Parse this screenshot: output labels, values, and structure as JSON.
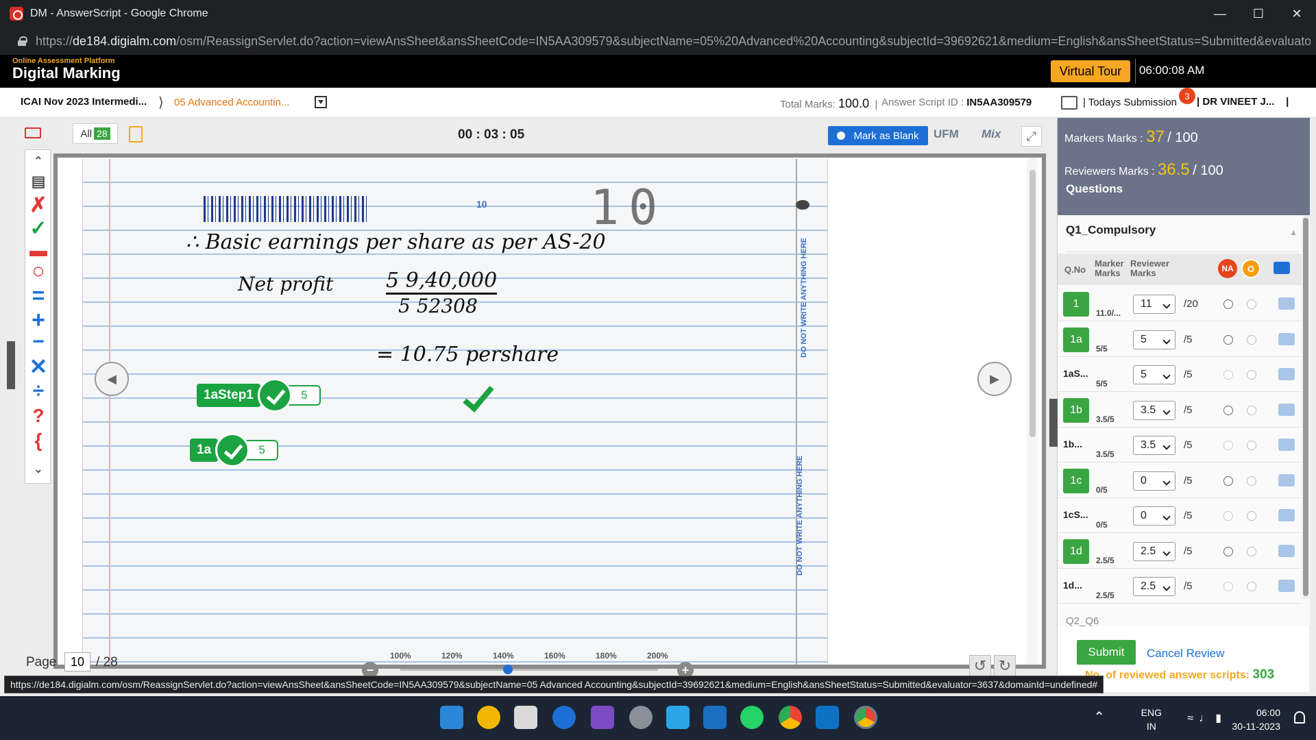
{
  "browser": {
    "title": "DM - AnswerScript - Google Chrome",
    "url_prefix": "https://",
    "url_host": "de184.digialm.com",
    "url_path": "/osm/ReassignServlet.do?action=viewAnsSheet&ansSheetCode=IN5AA309579&subjectName=05%20Advanced%20Accounting&subjectId=39692621&medium=English&ansSheetStatus=Submitted&evaluator=...",
    "status_url": "https://de184.digialm.com/osm/ReassignServlet.do?action=viewAnsSheet&ansSheetCode=IN5AA309579&subjectName=05 Advanced Accounting&subjectId=39692621&medium=English&ansSheetStatus=Submitted&evaluator=3637&domainId=undefined#"
  },
  "header": {
    "brand_sub": "Online Assessment Platform",
    "brand": "Digital Marking",
    "tour_label": "Virtual Tour",
    "clock": "06:00:08 AM"
  },
  "crumbs": {
    "exam": "ICAI Nov 2023 Intermedi...",
    "subject": "05 Advanced Accountin...",
    "total_marks_label": "Total Marks:",
    "total_marks": "100.0",
    "script_id_label": "Answer Script ID :",
    "script_id": "IN5AA309579",
    "todays_submission": "Todays Submission",
    "submission_badge": "3",
    "user": "DR VINEET J..."
  },
  "viewer": {
    "all_label": "All",
    "all_count": "28",
    "timer": "00 : 03 : 05",
    "mark_blank": "Mark as Blank",
    "ufm": "UFM",
    "mix": "Mix",
    "page_label": "Page",
    "page_value": "10",
    "page_total": "/ 28",
    "zoom_levels": [
      "100%",
      "120%",
      "140%",
      "160%",
      "180%",
      "200%"
    ]
  },
  "sheet": {
    "page_no": "10",
    "dots": "10",
    "line1": "∴  Basic  earnings  per share  as  per  AS-20",
    "line2": "Net profit",
    "numerator": "5 9,40,000",
    "denominator": "5 52308",
    "result": "=   10.75  pershare",
    "side_note": "DO NOT WRITE ANYTHING HERE",
    "annotations": [
      {
        "label": "1aStep1",
        "marks": "5"
      },
      {
        "label": "1a",
        "marks": "5"
      }
    ]
  },
  "panel": {
    "markers_label": "Markers Marks :",
    "markers_value": "37",
    "markers_total": "/ 100",
    "reviewers_label": "Reviewers Marks :",
    "reviewers_value": "36.5",
    "reviewers_total": "/ 100",
    "questions_label": "Questions",
    "section": "Q1_Compulsory",
    "col_qno": "Q.No",
    "col_marker": "Marker Marks",
    "col_reviewer": "Reviewer Marks",
    "na": "NA",
    "o": "O",
    "rows": [
      {
        "q": "1",
        "boxed": true,
        "marker": "11.0/...",
        "value": "11",
        "max": "/20"
      },
      {
        "q": "1a",
        "boxed": true,
        "marker": "5/5",
        "value": "5",
        "max": "/5"
      },
      {
        "q": "1aS...",
        "boxed": false,
        "marker": "5/5",
        "value": "5",
        "max": "/5"
      },
      {
        "q": "1b",
        "boxed": true,
        "marker": "3.5/5",
        "value": "3.5",
        "max": "/5"
      },
      {
        "q": "1b...",
        "boxed": false,
        "marker": "3.5/5",
        "value": "3.5",
        "max": "/5"
      },
      {
        "q": "1c",
        "boxed": true,
        "marker": "0/5",
        "value": "0",
        "max": "/5"
      },
      {
        "q": "1cS...",
        "boxed": false,
        "marker": "0/5",
        "value": "0",
        "max": "/5"
      },
      {
        "q": "1d",
        "boxed": true,
        "marker": "2.5/5",
        "value": "2.5",
        "max": "/5"
      },
      {
        "q": "1d...",
        "boxed": false,
        "marker": "2.5/5",
        "value": "2.5",
        "max": "/5"
      }
    ],
    "next_section": "Q2_Q6",
    "submit": "Submit",
    "cancel_review": "Cancel Review",
    "scripts_label": "No. of reviewed answer scripts:",
    "scripts_value": "303"
  },
  "taskbar": {
    "lang1": "ENG",
    "lang2": "IN",
    "time": "06:00",
    "date": "30-11-2023"
  },
  "colors": {
    "accent_green": "#3aa641",
    "accent_orange": "#f5a623",
    "accent_blue": "#1d6fd6"
  }
}
